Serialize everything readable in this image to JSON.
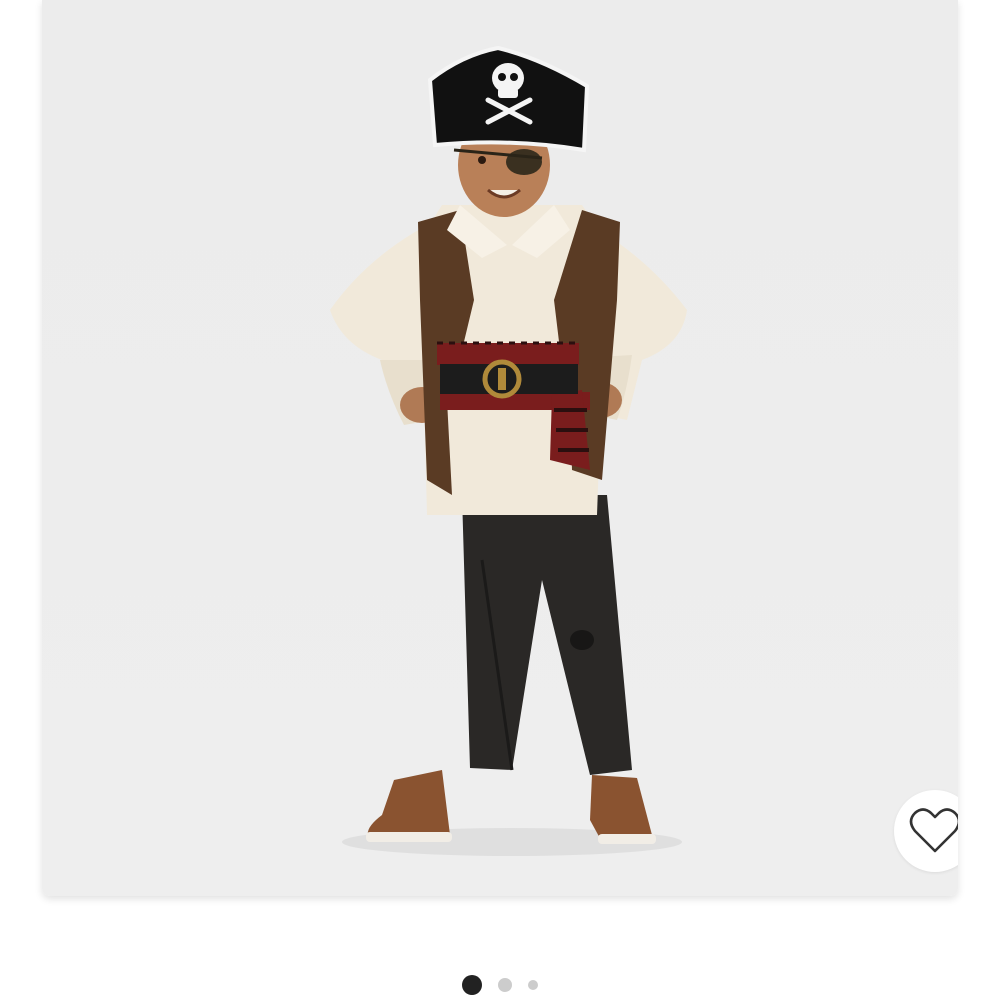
{
  "product_gallery": {
    "image_subject": "child-pirate-costume",
    "favorite_icon": "heart-outline-icon",
    "pager": {
      "total": 3,
      "active_index": 0
    }
  },
  "colors": {
    "card_background": "#ededed",
    "dot_active": "#222222",
    "dot_inactive": "#cccccc",
    "heart_stroke": "#333333"
  }
}
